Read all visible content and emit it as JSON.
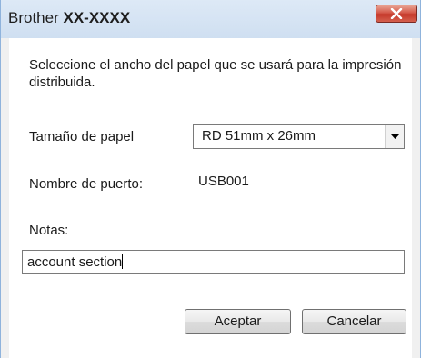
{
  "window": {
    "title_brand": "Brother",
    "title_model": "XX-XXXX",
    "close_icon": "close-x-icon",
    "close_color": "#c5382a"
  },
  "dialog": {
    "instructions": "Seleccione el ancho del papel que se usará para la impresión distribuida.",
    "paper_size_label": "Tamaño de papel",
    "paper_size_value": "RD 51mm x 26mm",
    "port_name_label": "Nombre de puerto:",
    "port_name_value": "USB001",
    "notes_label": "Notas:",
    "notes_value": "account section"
  },
  "buttons": {
    "ok_label": "Aceptar",
    "cancel_label": "Cancelar"
  }
}
